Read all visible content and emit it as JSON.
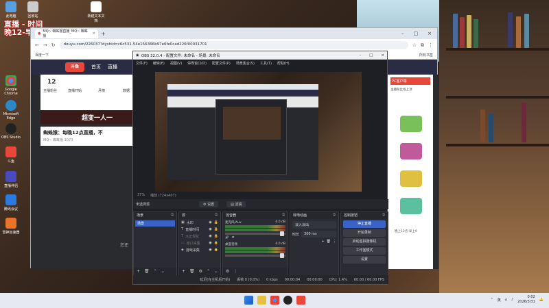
{
  "overlay": {
    "line1": "直播 - 时间",
    "line2": "晚12-早10"
  },
  "desktop": {
    "icons": [
      "此电脑",
      "回收站",
      "新建文本文档",
      "Google Chrome",
      "Microsoft Edge",
      "OBS Studio",
      "斗鱼",
      "直播伴侣",
      "腾讯会议",
      "雷神加速器"
    ]
  },
  "browser": {
    "tab_label": "MQ~ 蜘蛛猴直播_MQ~ 蜘蛛猴",
    "new_tab": "+",
    "url": "douyu.com/226037?dyshid=c6c531-54e156366b97e6fe0cad226f00031701",
    "bookmark_left": "百度一下",
    "bookmark_right": "所有书签",
    "nav": {
      "logo": "斗鱼",
      "home": "首页",
      "live": "直播"
    },
    "stats": {
      "count": "12",
      "label1": "主播粉丝",
      "label2": "直播开始",
      "label3": "月榜",
      "label4": "数据"
    },
    "banner": "超变一人一",
    "streamer_title": "蜘蛛猴：每晚12点直播，不",
    "streamer_sub": "MQ~ 蜘蛛猴  1073",
    "side_label": "PC客户端",
    "side_sub": "主播粉丝线上顶",
    "chat_hint": "您还",
    "chat_time": "晚上12点-早上9"
  },
  "obs": {
    "title": "OBS 32.0.4 - 配置文件: 未命名 - 场景: 未命名",
    "menu": [
      "文件(F)",
      "编辑(E)",
      "视图(V)",
      "停靠窗口(D)",
      "配置文件(P)",
      "场景集合(S)",
      "工具(T)",
      "帮助(H)"
    ],
    "zoom": "37%",
    "canvas": "缩放 (724x407)",
    "no_source": "未选择源",
    "settings_btn": "设置",
    "filters_btn": "滤镜",
    "scenes_title": "场景",
    "scene_item": "场景",
    "sources_title": "源",
    "sources": [
      "水印",
      "直播时间",
      "大正规化",
      "窗口采集",
      "游戏采集"
    ],
    "mixer_title": "混音器",
    "channels": [
      {
        "name": "麦克风/Aux",
        "db": "0.0 dB"
      },
      {
        "name": "桌面音频",
        "db": "0.0 dB"
      }
    ],
    "transitions_title": "转场动画",
    "transition_select": "淡入淡出",
    "duration_label": "时长",
    "duration_value": "300 ms",
    "controls_title": "控制按钮",
    "controls": [
      "停止直播",
      "开始录制",
      "启动虚拟摄像机",
      "工作室模式",
      "设置"
    ],
    "status": {
      "delay": "延迟(在主机后开始)",
      "dropped": "丢帧 0 (0.0%)",
      "bitrate": "0 kbps",
      "live_time": "00:00:04",
      "rec_time": "00:00:00",
      "cpu": "CPU: 1.4%",
      "fps": "60.00 / 60.00 FPS"
    }
  },
  "taskbar": {
    "lang": "英",
    "time": "0:02",
    "date": "2026/3/31"
  }
}
